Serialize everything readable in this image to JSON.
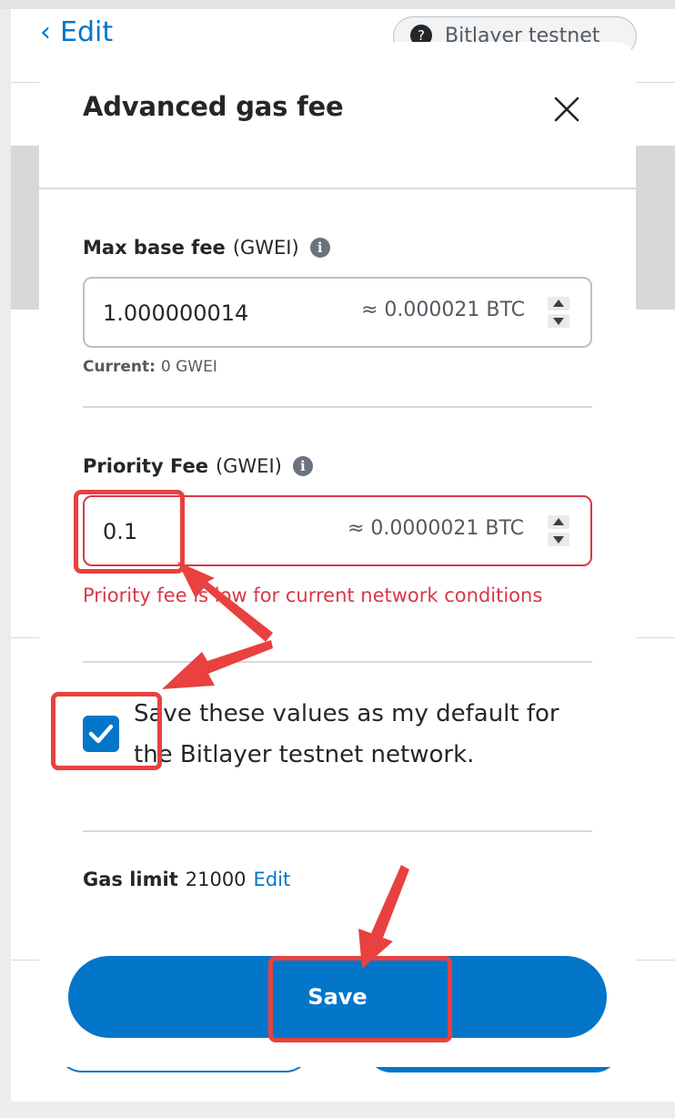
{
  "background": {
    "back_label": "Edit",
    "network_badge": "Bitlayer testnet"
  },
  "modal": {
    "title": "Advanced gas fee",
    "max_base_fee": {
      "label": "Max base fee",
      "unit": "(GWEI)",
      "value": "1.000000014",
      "conversion": "≈ 0.000021 BTC",
      "current_label": "Current:",
      "current_value": "0 GWEI"
    },
    "priority_fee": {
      "label": "Priority Fee",
      "unit": "(GWEI)",
      "value": "0.1",
      "conversion": "≈ 0.0000021 BTC",
      "error": "Priority fee is low for current network conditions"
    },
    "save_default": {
      "checked": true,
      "label": "Save these values as my default for the Bitlayer testnet network."
    },
    "gas_limit": {
      "label": "Gas limit",
      "value": "21000",
      "edit_label": "Edit"
    },
    "save_label": "Save"
  },
  "colors": {
    "primary": "#0376c9",
    "error": "#d73847",
    "annotation": "#e8413f"
  }
}
